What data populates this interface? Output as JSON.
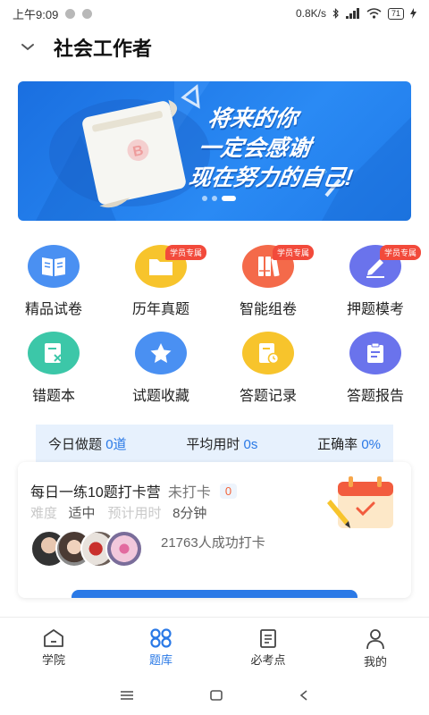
{
  "status_bar": {
    "time": "上午9:09",
    "network_speed": "0.8K/s",
    "battery": "71"
  },
  "header": {
    "title": "社会工作者"
  },
  "banner": {
    "line1": "将来的你",
    "line2": "一定会感谢",
    "line3": "现在努力的自己!"
  },
  "features": [
    {
      "label": "精品试卷",
      "icon": "book-icon",
      "color": "#4a90f2",
      "badge": ""
    },
    {
      "label": "历年真题",
      "icon": "folder-icon",
      "color": "#f7c42c",
      "badge": "学员专属"
    },
    {
      "label": "智能组卷",
      "icon": "binders-icon",
      "color": "#f46a4a",
      "badge": "学员专属"
    },
    {
      "label": "押题模考",
      "icon": "pen-icon",
      "color": "#6a73ec",
      "badge": "学员专属"
    },
    {
      "label": "错题本",
      "icon": "error-note-icon",
      "color": "#3cc7a8",
      "badge": ""
    },
    {
      "label": "试题收藏",
      "icon": "star-icon",
      "color": "#4a90f2",
      "badge": ""
    },
    {
      "label": "答题记录",
      "icon": "record-icon",
      "color": "#f7c42c",
      "badge": ""
    },
    {
      "label": "答题报告",
      "icon": "report-icon",
      "color": "#6a73ec",
      "badge": ""
    }
  ],
  "stats": {
    "today_label": "今日做题",
    "today_value": "0道",
    "avg_label": "平均用时",
    "avg_value": "0s",
    "accuracy_label": "正确率",
    "accuracy_value": "0%"
  },
  "checkin": {
    "title": "每日一练10题打卡营",
    "status": "未打卡",
    "count": "0",
    "difficulty_label": "难度",
    "difficulty_value": "适中",
    "time_label": "预计用时",
    "time_value": "8分钟",
    "people": "21763人成功打卡"
  },
  "bottom_nav": [
    {
      "label": "学院",
      "icon": "home-icon",
      "active": false
    },
    {
      "label": "题库",
      "icon": "grid-icon",
      "active": true
    },
    {
      "label": "必考点",
      "icon": "document-icon",
      "active": false
    },
    {
      "label": "我的",
      "icon": "person-icon",
      "active": false
    }
  ],
  "colors": {
    "accent": "#2a79e6",
    "badge": "#f24a3b"
  }
}
